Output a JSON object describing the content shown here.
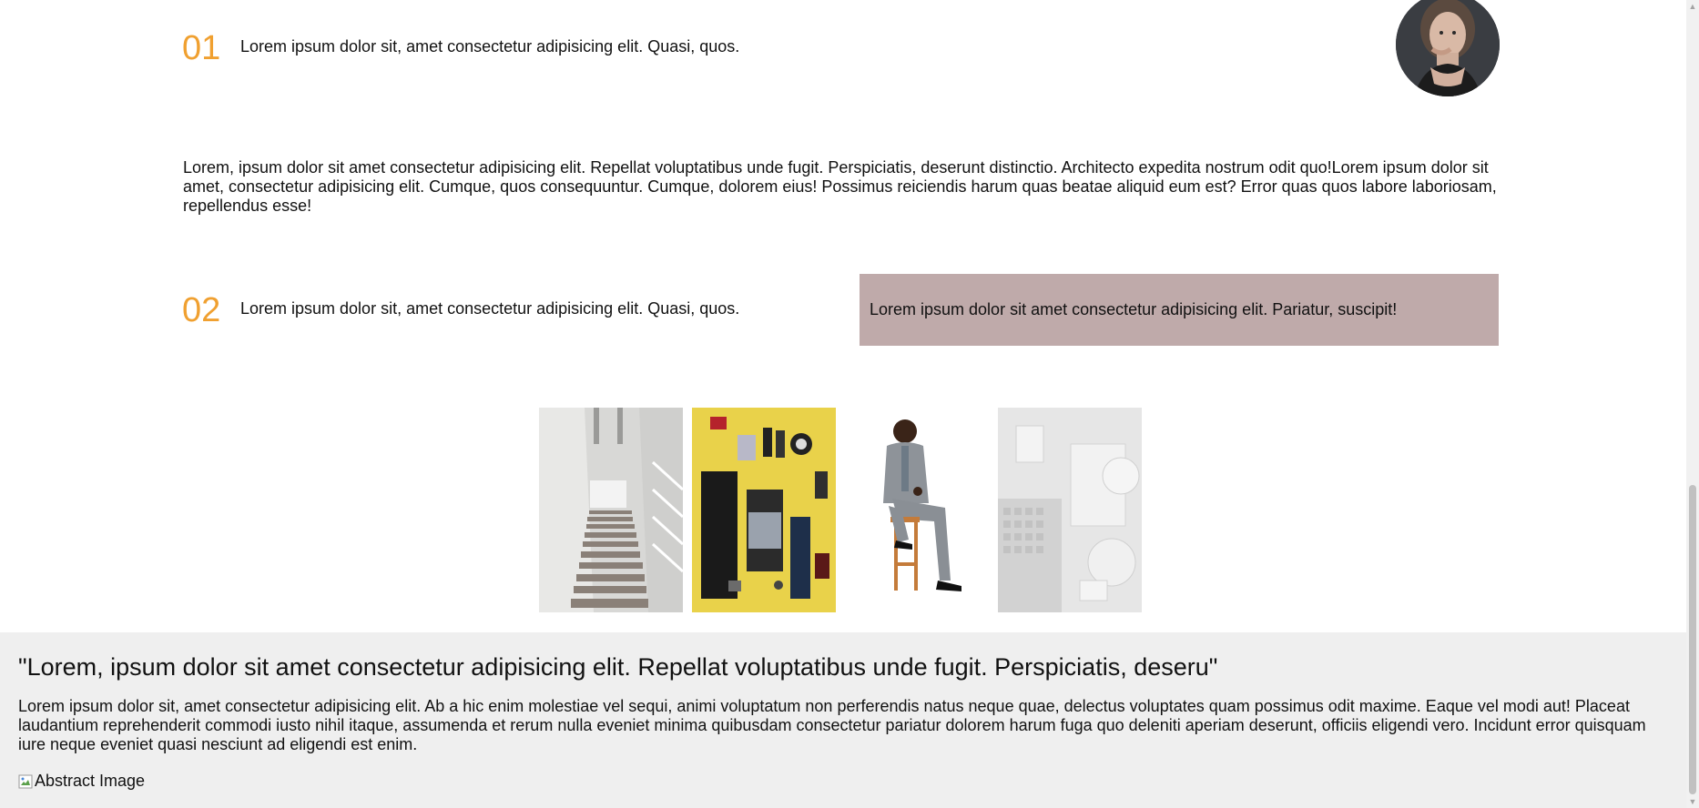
{
  "items": [
    {
      "number": "01",
      "text": "Lorem ipsum dolor sit, amet consectetur adipisicing elit. Quasi, quos."
    },
    {
      "number": "02",
      "text": "Lorem ipsum dolor sit, amet consectetur adipisicing elit. Quasi, quos."
    }
  ],
  "intro_paragraph": "Lorem, ipsum dolor sit amet consectetur adipisicing elit. Repellat voluptatibus unde fugit. Perspiciatis, deserunt distinctio. Architecto expedita nostrum odit quo!Lorem ipsum dolor sit amet, consectetur adipisicing elit. Cumque, quos consequuntur. Cumque, dolorem eius! Possimus reiciendis harum quas beatae aliquid eum est? Error quas quos labore laboriosam, repellendus esse!",
  "highlight_box": "Lorem ipsum dolor sit amet consectetur adipisicing elit. Pariatur, suscipit!",
  "footer": {
    "quote": "\"Lorem, ipsum dolor sit amet consectetur adipisicing elit. Repellat voluptatibus unde fugit. Perspiciatis, deseru\"",
    "text": "Lorem ipsum dolor sit, amet consectetur adipisicing elit. Ab a hic enim molestiae vel sequi, animi voluptatum non perferendis natus neque quae, delectus voluptates quam possimus odit maxime. Eaque vel modi aut! Placeat laudantium reprehenderit commodi iusto nihil itaque, assumenda et rerum nulla eveniet minima quibusdam consectetur pariatur dolorem harum fuga quo deleniti aperiam deserunt, officiis eligendi vero. Incidunt error quisquam iure neque eveniet quasi nesciunt ad eligendi est enim.",
    "broken_image_alt": "Abstract Image"
  },
  "colors": {
    "accent_number": "#f0a030",
    "highlight_bg": "#bfaaaa",
    "footer_bg": "#efefef"
  }
}
